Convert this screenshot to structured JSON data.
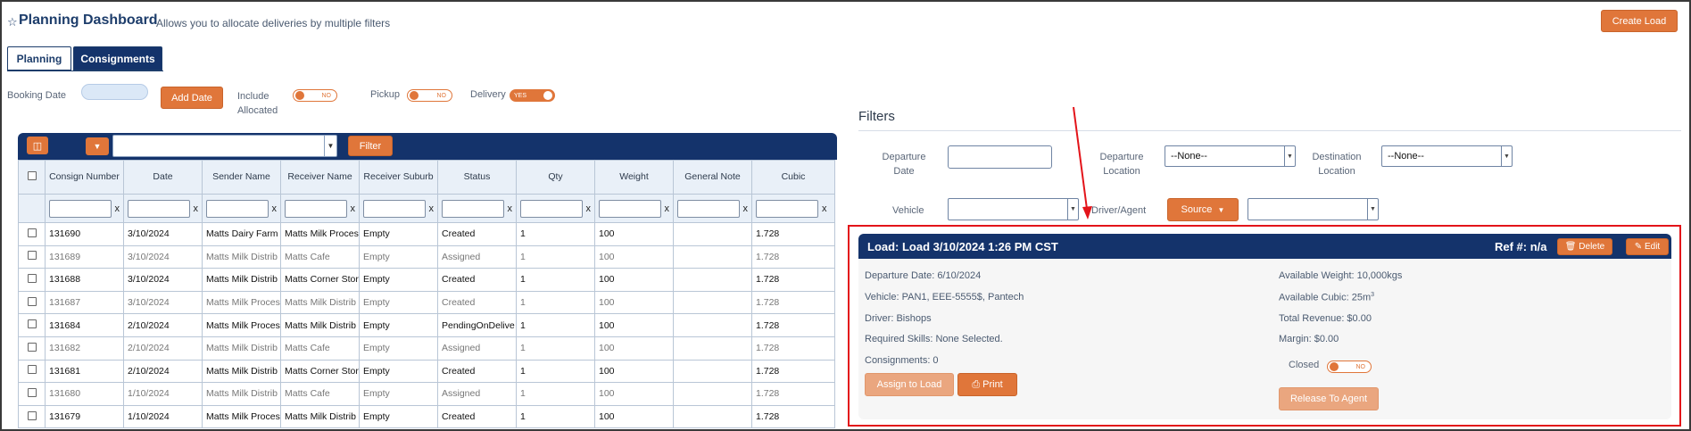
{
  "header": {
    "title": "Planning Dashboard",
    "subtitle": "Allows you to allocate deliveries by multiple filters",
    "create_load": "Create Load"
  },
  "tabs": [
    {
      "label": "Planning",
      "active": false
    },
    {
      "label": "Consignments",
      "active": true
    }
  ],
  "booking": {
    "booking_date_label": "Booking Date",
    "add_date": "Add Date",
    "include_allocated_label": "Include\nAllocated",
    "include_allocated_toggle": "NO",
    "pickup_label": "Pickup",
    "pickup_toggle": "NO",
    "delivery_label": "Delivery",
    "delivery_toggle": "YES"
  },
  "grid": {
    "filter_button": "Filter",
    "columns": [
      "Consign Number",
      "Date",
      "Sender Name",
      "Receiver Name",
      "Receiver Suburb",
      "Status",
      "Qty",
      "Weight",
      "General Note",
      "Cubic"
    ],
    "filter_clear": "x",
    "rows": [
      {
        "consign": "131690",
        "date": "3/10/2024",
        "sender": "Matts Dairy Farm",
        "receiver": "Matts Milk Proces",
        "suburb": "Empty",
        "status": "Created",
        "qty": "1",
        "weight": "100",
        "note": "",
        "cubic": "1.728",
        "dim": false
      },
      {
        "consign": "131689",
        "date": "3/10/2024",
        "sender": "Matts Milk Distrib",
        "receiver": "Matts Cafe",
        "suburb": "Empty",
        "status": "Assigned",
        "qty": "1",
        "weight": "100",
        "note": "",
        "cubic": "1.728",
        "dim": true
      },
      {
        "consign": "131688",
        "date": "3/10/2024",
        "sender": "Matts Milk Distrib",
        "receiver": "Matts Corner Stor",
        "suburb": "Empty",
        "status": "Created",
        "qty": "1",
        "weight": "100",
        "note": "",
        "cubic": "1.728",
        "dim": false
      },
      {
        "consign": "131687",
        "date": "3/10/2024",
        "sender": "Matts Milk Proces",
        "receiver": "Matts Milk Distrib",
        "suburb": "Empty",
        "status": "Created",
        "qty": "1",
        "weight": "100",
        "note": "",
        "cubic": "1.728",
        "dim": true
      },
      {
        "consign": "131684",
        "date": "2/10/2024",
        "sender": "Matts Milk Proces",
        "receiver": "Matts Milk Distrib",
        "suburb": "Empty",
        "status": "PendingOnDelive",
        "qty": "1",
        "weight": "100",
        "note": "",
        "cubic": "1.728",
        "dim": false
      },
      {
        "consign": "131682",
        "date": "2/10/2024",
        "sender": "Matts Milk Distrib",
        "receiver": "Matts Cafe",
        "suburb": "Empty",
        "status": "Assigned",
        "qty": "1",
        "weight": "100",
        "note": "",
        "cubic": "1.728",
        "dim": true
      },
      {
        "consign": "131681",
        "date": "2/10/2024",
        "sender": "Matts Milk Distrib",
        "receiver": "Matts Corner Stor",
        "suburb": "Empty",
        "status": "Created",
        "qty": "1",
        "weight": "100",
        "note": "",
        "cubic": "1.728",
        "dim": false
      },
      {
        "consign": "131680",
        "date": "1/10/2024",
        "sender": "Matts Milk Distrib",
        "receiver": "Matts Cafe",
        "suburb": "Empty",
        "status": "Assigned",
        "qty": "1",
        "weight": "100",
        "note": "",
        "cubic": "1.728",
        "dim": true
      },
      {
        "consign": "131679",
        "date": "1/10/2024",
        "sender": "Matts Milk Proces",
        "receiver": "Matts Milk Distrib",
        "suburb": "Empty",
        "status": "Created",
        "qty": "1",
        "weight": "100",
        "note": "",
        "cubic": "1.728",
        "dim": false
      }
    ]
  },
  "filters": {
    "title": "Filters",
    "departure_date_label": "Departure\nDate",
    "departure_location_label": "Departure\nLocation",
    "departure_location_value": "--None--",
    "destination_location_label": "Destination\nLocation",
    "destination_location_value": "--None--",
    "vehicle_label": "Vehicle",
    "driver_agent_label": "Driver/Agent",
    "source_button": "Source"
  },
  "load": {
    "title": "Load: Load 3/10/2024 1:26 PM CST",
    "ref": "Ref #: n/a",
    "delete": "Delete",
    "edit": "Edit",
    "departure_date": "Departure Date: 6/10/2024",
    "vehicle": "Vehicle: PAN1, EEE-5555$, Pantech",
    "driver": "Driver: Bishops",
    "required_skills": "Required Skills: None Selected.",
    "consignments": "Consignments: 0",
    "available_weight": "Available Weight: 10,000kgs",
    "available_cubic": "Available Cubic: 25m",
    "available_cubic_sup": "3",
    "total_revenue": "Total Revenue: $0.00",
    "margin": "Margin: $0.00",
    "closed_label": "Closed",
    "closed_toggle": "NO",
    "assign_to_load": "Assign to Load",
    "print": "Print",
    "release_to_agent": "Release To Agent"
  },
  "colors": {
    "brand_navy": "#14336b",
    "accent_orange": "#e0763a",
    "annotation_red": "#e3141a"
  }
}
